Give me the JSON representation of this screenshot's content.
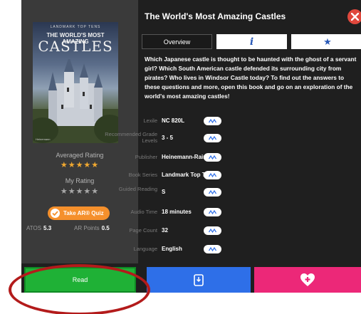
{
  "book": {
    "title": "The World's Most Amazing Castles",
    "cover": {
      "series": "LANDMARK TOP TENS",
      "line1": "THE WORLD'S MOST AMAZING",
      "line2": "CASTLES",
      "publisher": "Heinemann"
    },
    "description": "Which Japanese castle is thought to be haunted with the ghost of a servant girl? Which South American castle defended its surrounding city from pirates? Who lives in Windsor Castle today? To find out the answers to these questions and more, open this book and go on an exploration of the world's most amazing castles!"
  },
  "tabs": {
    "overview": "Overview",
    "info_icon": "info-icon",
    "star_icon": "star-icon"
  },
  "ratings": {
    "averaged_label": "Averaged Rating",
    "averaged_stars": "★★★★★",
    "averaged_value": 5,
    "my_label": "My Rating",
    "my_stars": "★★★★★",
    "my_value": 0
  },
  "ar": {
    "quiz_label": "Take AR® Quiz",
    "atos_label": "ATOS",
    "atos_value": "5.3",
    "points_label": "AR Points",
    "points_value": "0.5"
  },
  "details": [
    {
      "label": "Lexile",
      "value": "NC 820L"
    },
    {
      "label": "Recommended Grade Levels",
      "value": "3 - 5"
    },
    {
      "label": "Publisher",
      "value": "Heinemann-Raintree"
    },
    {
      "label": "Book Series",
      "value": "Landmark Top Tens"
    },
    {
      "label": "Guided Reading",
      "value": "S"
    },
    {
      "label": "Audio Time",
      "value": "18 minutes"
    },
    {
      "label": "Page Count",
      "value": "32"
    },
    {
      "label": "Language",
      "value": "English"
    }
  ],
  "actions": {
    "read": "Read"
  },
  "colors": {
    "read": "#1fb136",
    "book": "#2e6fe8",
    "favorite": "#ec2878",
    "ar_quiz": "#f5902c",
    "close": "#e0483d",
    "annotation": "#b31b1b"
  }
}
